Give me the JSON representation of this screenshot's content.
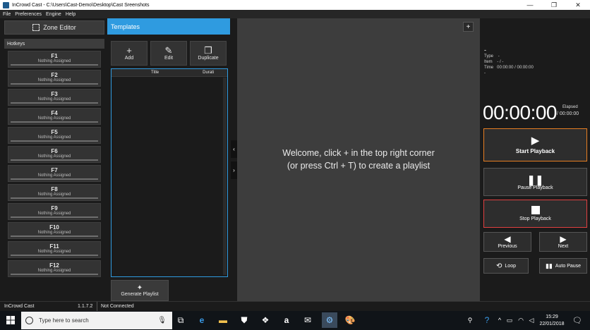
{
  "window": {
    "title": "InCrowd Cast - C:\\Users\\Cast-Demo\\Desktop\\Cast Sreenshots",
    "controls": {
      "minimize": "—",
      "restore": "❐",
      "close": "✕"
    }
  },
  "menu": [
    "File",
    "Preferences",
    "Engine",
    "Help"
  ],
  "left": {
    "zone_editor_label": "Zone Editor",
    "hotkeys_header": "Hotkeys",
    "hotkeys": [
      {
        "key": "F1",
        "status": "Nothing Assigned"
      },
      {
        "key": "F2",
        "status": "Nothing Assigned"
      },
      {
        "key": "F3",
        "status": "Nothing Assigned"
      },
      {
        "key": "F4",
        "status": "Nothing Assigned"
      },
      {
        "key": "F5",
        "status": "Nothing Assigned"
      },
      {
        "key": "F6",
        "status": "Nothing Assigned"
      },
      {
        "key": "F7",
        "status": "Nothing Assigned"
      },
      {
        "key": "F8",
        "status": "Nothing Assigned"
      },
      {
        "key": "F9",
        "status": "Nothing Assigned"
      },
      {
        "key": "F10",
        "status": "Nothing Assigned"
      },
      {
        "key": "F11",
        "status": "Nothing Assigned"
      },
      {
        "key": "F12",
        "status": "Nothing Assigned"
      }
    ]
  },
  "templates": {
    "header": "Templates",
    "add_label": "Add",
    "edit_label": "Edit",
    "duplicate_label": "Duplicate",
    "col_title": "Title",
    "col_duration": "Durati",
    "generate_label": "Generate Playlist"
  },
  "main": {
    "plus_label": "+",
    "welcome_line1": "Welcome, click + in the top right corner",
    "welcome_line2": "(or press Ctrl + T) to create a playlist"
  },
  "right": {
    "dash": "-",
    "type_label": "Type",
    "type_value": "-",
    "item_label": "Item",
    "item_value": "- / -",
    "time_label": "Time",
    "time_value": "00:00:00 / 00:00:00",
    "extra_dash": "-",
    "timer": "00:00:00",
    "elapsed_label": "Elapsed",
    "elapsed_value": "/ 00:00:00",
    "start_label": "Start Playback",
    "pause_label": "Pause Playback",
    "stop_label": "Stop Playback",
    "previous_label": "Previous",
    "next_label": "Next",
    "loop_label": "Loop",
    "autopause_label": "Auto Pause",
    "start_border": "#e67e22",
    "stop_border": "#e04040"
  },
  "status": {
    "app_name": "InCrowd Cast",
    "version": "1.1.7.2",
    "connection": "Not Connected"
  },
  "taskbar": {
    "search_placeholder": "Type here to search",
    "time": "15:29",
    "date": "22/01/2018"
  }
}
